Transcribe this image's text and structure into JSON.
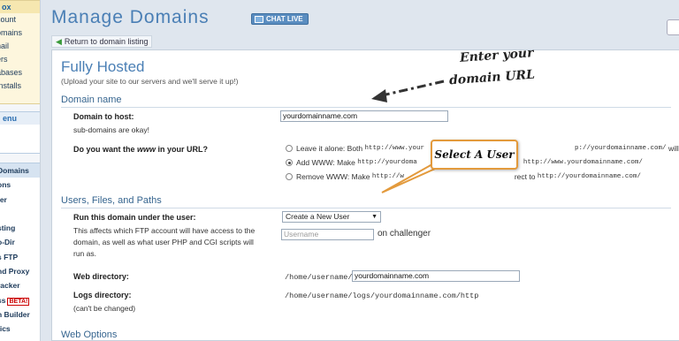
{
  "sidebar": {
    "box1_head": "ox",
    "box1_items": [
      "count",
      "omains",
      "nail",
      "ers",
      "abases",
      "Installs"
    ],
    "box2_head": "enu",
    "box3_items": [
      "Domains",
      "ons",
      "fer",
      "",
      "sting",
      "o-Dir",
      "s FTP",
      "nd Proxy",
      "racker",
      "ss",
      "n Builder",
      "tics"
    ],
    "beta_label": "BETA!"
  },
  "header": {
    "title": "Manage Domains",
    "chat_label": "CHAT LIVE"
  },
  "return_link": "Return to domain listing",
  "main": {
    "title": "Fully Hosted",
    "subtitle": "(Upload your site to our servers and we'll serve it up!)",
    "domain_section": {
      "title": "Domain name",
      "host_label": "Domain to host:",
      "host_hint": "sub-domains are okay!",
      "host_value": "yourdomainname.com",
      "www_label": "Do you want the www in your URL?",
      "www_label_pre": "Do you want the ",
      "www_label_em": "www",
      "www_label_post": " in your URL?",
      "options": [
        {
          "text": "Leave it alone: Both",
          "mono1": "http://www.your",
          "mono2": "p://yourdomainname.com/",
          "tail": "will work.",
          "checked": false
        },
        {
          "text": "Add WWW: Make",
          "mono1": "http://yourdoma",
          "mono2": "http://www.yourdomainname.com/",
          "tail": "",
          "checked": true
        },
        {
          "text": "Remove WWW: Make",
          "mono1": "http://w",
          "mono2": "http://yourdomainname.com/",
          "tail": "",
          "checked": false
        }
      ],
      "redirect_fragment": "rect to"
    },
    "users_section": {
      "title": "Users, Files, and Paths",
      "run_label": "Run this domain under the user:",
      "run_desc": "This affects which FTP account will have access to the domain, as well as what user PHP and CGI scripts will run as.",
      "run_desc_lines": [
        "This affects which FTP account will have access to the",
        "domain, as well as what user PHP and CGI scripts will",
        "run as."
      ],
      "user_select": "Create a New User",
      "username_placeholder": "Username",
      "on_server": "on challenger",
      "web_dir_label": "Web directory:",
      "web_dir_prefix": "/home/username/",
      "web_dir_value": "yourdomainname.com",
      "logs_label": "Logs directory:",
      "logs_hint": "(can't be changed)",
      "logs_value": "/home/username/logs/yourdomainname.com/http"
    },
    "web_options_title": "Web Options"
  },
  "annotations": {
    "enter_line1": "Enter your",
    "enter_line2": "domain URL",
    "callout": "Select A User"
  },
  "colors": {
    "accent": "#4a7fb5",
    "callout_border": "#e39a3c"
  }
}
